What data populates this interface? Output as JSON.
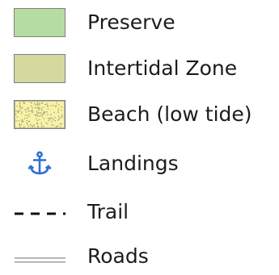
{
  "legend": {
    "items": [
      {
        "label": "Preserve",
        "icon": "preserve-swatch",
        "color": "#b5dca3"
      },
      {
        "label": "Intertidal Zone",
        "icon": "intertidal-swatch",
        "color": "#d6d99d"
      },
      {
        "label": "Beach (low tide)",
        "icon": "beach-swatch",
        "color": "#f7f2a6",
        "pattern_color": "#9c9a7d"
      },
      {
        "label": "Landings",
        "icon": "anchor-icon",
        "color": "#2f6fd6"
      },
      {
        "label": "Trail",
        "icon": "dashed-line-icon",
        "color": "#111111"
      },
      {
        "label": "Roads",
        "icon": "double-line-icon",
        "color": "#8a8a8a"
      }
    ]
  }
}
